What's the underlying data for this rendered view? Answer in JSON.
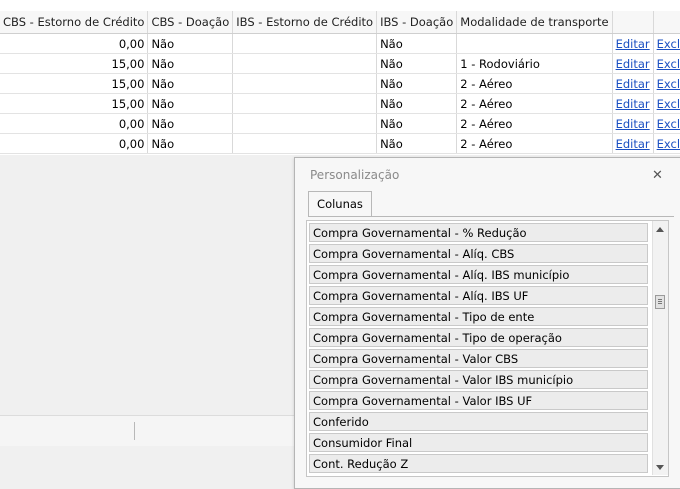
{
  "grid": {
    "columns": [
      "CBS - Estorno de Crédito",
      "CBS - Doação",
      "IBS - Estorno de Crédito",
      "IBS - Doação",
      "Modalidade de transporte",
      "",
      ""
    ],
    "rows": [
      {
        "cbs_estorno": "0,00",
        "cbs_doacao": "Não",
        "ibs_estorno": "",
        "ibs_doacao": "Não",
        "modalidade": "",
        "edit": "Editar",
        "delete": "Excluir"
      },
      {
        "cbs_estorno": "15,00",
        "cbs_doacao": "Não",
        "ibs_estorno": "",
        "ibs_doacao": "Não",
        "modalidade": "1 - Rodoviário",
        "edit": "Editar",
        "delete": "Excluir"
      },
      {
        "cbs_estorno": "15,00",
        "cbs_doacao": "Não",
        "ibs_estorno": "",
        "ibs_doacao": "Não",
        "modalidade": "2 - Aéreo",
        "edit": "Editar",
        "delete": "Excluir"
      },
      {
        "cbs_estorno": "15,00",
        "cbs_doacao": "Não",
        "ibs_estorno": "",
        "ibs_doacao": "Não",
        "modalidade": "2 - Aéreo",
        "edit": "Editar",
        "delete": "Excluir"
      },
      {
        "cbs_estorno": "0,00",
        "cbs_doacao": "Não",
        "ibs_estorno": "",
        "ibs_doacao": "Não",
        "modalidade": "2 - Aéreo",
        "edit": "Editar",
        "delete": "Excluir"
      },
      {
        "cbs_estorno": "0,00",
        "cbs_doacao": "Não",
        "ibs_estorno": "",
        "ibs_doacao": "Não",
        "modalidade": "2 - Aéreo",
        "edit": "Editar",
        "delete": "Excluir"
      }
    ]
  },
  "panel": {
    "title": "Personalização",
    "close_icon": "close-icon",
    "tab_label": "Colunas",
    "items": [
      "Compra Governamental - % Redução",
      "Compra Governamental - Alíq. CBS",
      "Compra Governamental - Alíq. IBS município",
      "Compra Governamental - Alíq. IBS UF",
      "Compra Governamental - Tipo de ente",
      "Compra Governamental - Tipo de operação",
      "Compra Governamental - Valor CBS",
      "Compra Governamental - Valor IBS município",
      "Compra Governamental - Valor IBS UF",
      "Conferido",
      "Consumidor Final",
      "Cont. Redução Z"
    ],
    "scroll_position": 0.28
  }
}
